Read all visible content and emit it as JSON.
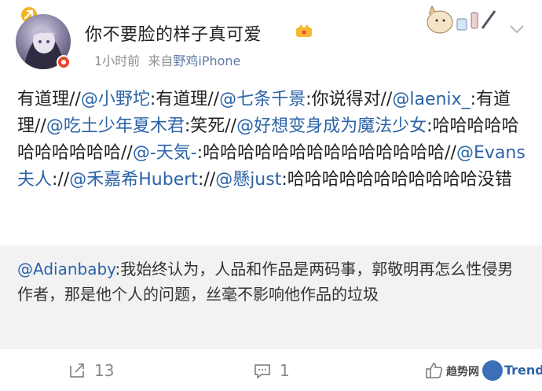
{
  "post": {
    "username": "你不要脸的样子真可爱",
    "time": "1小时前",
    "source_prefix": "来自",
    "source_device": "野鸡iPhone",
    "content": [
      {
        "t": "有道理//"
      },
      {
        "t": "@小野坨",
        "m": true
      },
      {
        "t": ":有道理//"
      },
      {
        "t": "@七条千景",
        "m": true
      },
      {
        "t": ":你说得对//"
      },
      {
        "t": "@laenix_",
        "m": true
      },
      {
        "t": ":有道理//"
      },
      {
        "t": "@吃土少年夏木君",
        "m": true
      },
      {
        "t": ":笑死//"
      },
      {
        "t": "@好想变身成为魔法少女",
        "m": true
      },
      {
        "t": ":哈哈哈哈哈哈哈哈哈哈哈//"
      },
      {
        "t": "@-天気-",
        "m": true
      },
      {
        "t": ":哈哈哈哈哈哈哈哈哈哈哈哈哈哈//"
      },
      {
        "t": "@Evans夫人",
        "m": true
      },
      {
        "t": "://"
      },
      {
        "t": "@禾嘉希Hubert",
        "m": true
      },
      {
        "t": "://"
      },
      {
        "t": "@懸just",
        "m": true
      },
      {
        "t": ":哈哈哈哈哈哈哈哈哈哈哈没错"
      }
    ]
  },
  "repost": {
    "content": [
      {
        "t": "@Adianbaby",
        "m": true
      },
      {
        "t": ":我始终认为，人品和作品是两码事，郭敬明再怎么性侵男作者，那是他个人的问题，丝毫不影响他作品的垃圾"
      }
    ]
  },
  "footer": {
    "share_count": "13",
    "comment_count": "1",
    "watermark_cn": "趋势网",
    "watermark_en": "Trend"
  },
  "icons": [
    "tag-icon",
    "vip-crown-icon",
    "chevron-down-icon",
    "share-icon",
    "comment-icon",
    "like-icon"
  ],
  "colors": {
    "mention": "#2c63a8",
    "meta": "#8f8f8f",
    "repost_bg": "#f2f2f2"
  }
}
